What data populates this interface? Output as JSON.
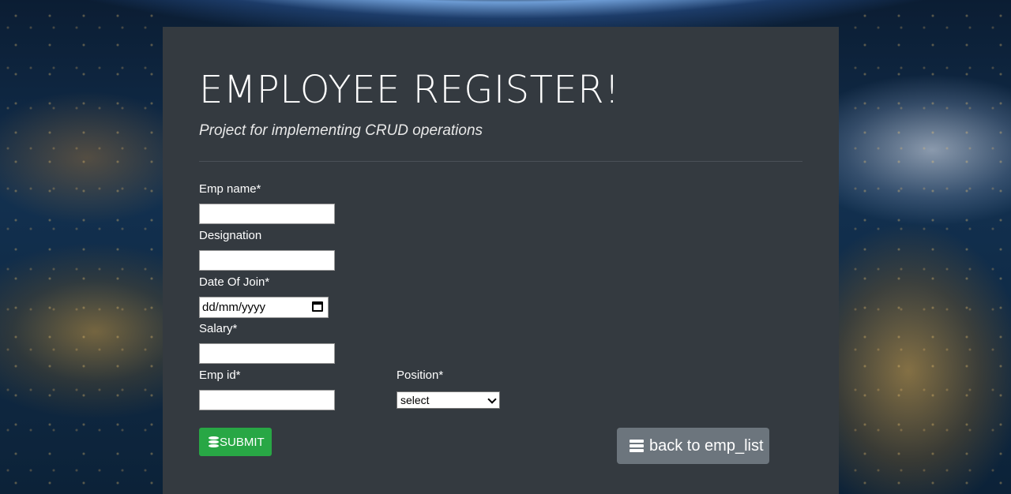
{
  "header": {
    "title": "EMPLOYEE REGISTER!",
    "subtitle": "Project for implementing CRUD operations"
  },
  "form": {
    "emp_name_label": "Emp name*",
    "emp_name_value": "",
    "designation_label": "Designation",
    "designation_value": "",
    "date_of_join_label": "Date Of Join*",
    "date_of_join_placeholder": "dd/mm/yyyy",
    "salary_label": "Salary*",
    "salary_value": "",
    "emp_id_label": "Emp id*",
    "emp_id_value": "",
    "position_label": "Position*",
    "position_selected": "select"
  },
  "buttons": {
    "submit_label": "SUBMIT",
    "back_label": "back to emp_list"
  },
  "icons": {
    "submit": "database-icon",
    "back": "list-icon",
    "date": "calendar-icon",
    "select": "chevron-down-icon"
  },
  "colors": {
    "panel": "#343a40",
    "submit": "#28a745",
    "back": "#6c757d"
  }
}
